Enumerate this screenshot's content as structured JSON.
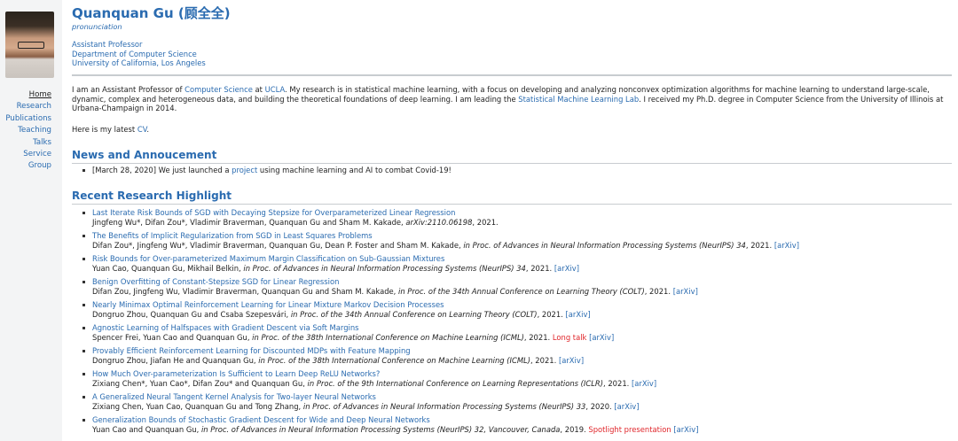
{
  "profile": {
    "name": "Quanquan Gu (顾全全)",
    "pronunciation": "pronunciation",
    "affiliation": [
      "Assistant Professor",
      "Department of Computer Science",
      "University of California, Los Angeles"
    ]
  },
  "nav": [
    "Home",
    "Research",
    "Publications",
    "Teaching",
    "Talks",
    "Service",
    "Group"
  ],
  "intro": {
    "p1_a": "I am an Assistant Professor of ",
    "p1_link1": "Computer Science",
    "p1_b": " at ",
    "p1_link2": "UCLA",
    "p1_c": ". My research is in statistical machine learning, with a focus on developing and analyzing nonconvex optimization algorithms for machine learning to understand large-scale, dynamic, complex and heterogeneous data, and building the theoretical foundations of deep learning. I am leading the ",
    "p1_link3": "Statistical Machine Learning Lab",
    "p1_d": ". I received my Ph.D. degree in Computer Science from the University of Illinois at Urbana-Champaign in 2014.",
    "p2_a": "Here is my latest ",
    "p2_link": "CV",
    "p2_b": "."
  },
  "news": {
    "heading": "News and Annoucement",
    "items": [
      {
        "a": "[March 28, 2020] We just launched a ",
        "link": "project",
        "b": " using machine learning and AI to combat Covid-19!"
      }
    ]
  },
  "research": {
    "heading": "Recent Research Highlight",
    "items": [
      {
        "title": "Last Iterate Risk Bounds of SGD with Decaying Stepsize for Overparameterized Linear Regression",
        "authors": "Jingfeng Wu*, Difan Zou*, Vladimir Braverman, Quanquan Gu and Sham M. Kakade, ",
        "venue": "arXiv:2110.06198",
        "year": ", 2021.",
        "badge": "",
        "arxiv": ""
      },
      {
        "title": "The Benefits of Implicit Regularization from SGD in Least Squares Problems",
        "authors": "Difan Zou*, Jingfeng Wu*, Vladimir Braverman, Quanquan Gu, Dean P. Foster and Sham M. Kakade, ",
        "venue": "in Proc. of Advances in Neural Information Processing Systems (NeurIPS) 34",
        "year": ", 2021. ",
        "badge": "",
        "arxiv": "[arXiv]"
      },
      {
        "title": "Risk Bounds for Over-parameterized Maximum Margin Classification on Sub-Gaussian Mixtures",
        "authors": "Yuan Cao, Quanquan Gu, Mikhail Belkin, ",
        "venue": "in Proc. of Advances in Neural Information Processing Systems (NeurIPS) 34",
        "year": ", 2021. ",
        "badge": "",
        "arxiv": "[arXiv]"
      },
      {
        "title": "Benign Overfitting of Constant-Stepsize SGD for Linear Regression",
        "authors": "Difan Zou, Jingfeng Wu, Vladimir Braverman, Quanquan Gu and Sham M. Kakade, ",
        "venue": "in Proc. of the 34th Annual Conference on Learning Theory (COLT)",
        "year": ", 2021. ",
        "badge": "",
        "arxiv": "[arXiv]"
      },
      {
        "title": "Nearly Minimax Optimal Reinforcement Learning for Linear Mixture Markov Decision Processes",
        "authors": "Dongruo Zhou, Quanquan Gu and Csaba Szepesvári, ",
        "venue": "in Proc. of the 34th Annual Conference on Learning Theory (COLT)",
        "year": ", 2021. ",
        "badge": "",
        "arxiv": "[arXiv]"
      },
      {
        "title": "Agnostic Learning of Halfspaces with Gradient Descent via Soft Margins",
        "authors": "Spencer Frei, Yuan Cao and Quanquan Gu, ",
        "venue": "in Proc. of the 38th International Conference on Machine Learning (ICML)",
        "year": ", 2021. ",
        "badge": "Long talk",
        "arxiv": "[arXiv]"
      },
      {
        "title": "Provably Efficient Reinforcement Learning for Discounted MDPs with Feature Mapping",
        "authors": "Dongruo Zhou, Jiafan He and Quanquan Gu, ",
        "venue": "in Proc. of the 38th International Conference on Machine Learning (ICML)",
        "year": ", 2021. ",
        "badge": "",
        "arxiv": "[arXiv]"
      },
      {
        "title": "How Much Over-parameterization Is Sufficient to Learn Deep ReLU Networks?",
        "authors": "Zixiang Chen*, Yuan Cao*, Difan Zou* and Quanquan Gu, ",
        "venue": "in Proc. of the 9th International Conference on Learning Representations (ICLR)",
        "year": ", 2021. ",
        "badge": "",
        "arxiv": "[arXiv]"
      },
      {
        "title": "A Generalized Neural Tangent Kernel Analysis for Two-layer Neural Networks",
        "authors": "Zixiang Chen, Yuan Cao, Quanquan Gu and Tong Zhang, ",
        "venue": "in Proc. of Advances in Neural Information Processing Systems (NeurIPS) 33",
        "year": ", 2020. ",
        "badge": "",
        "arxiv": "[arXiv]"
      },
      {
        "title": "Generalization Bounds of Stochastic Gradient Descent for Wide and Deep Neural Networks",
        "authors": "Yuan Cao and Quanquan Gu, ",
        "venue": "in Proc. of Advances in Neural Information Processing Systems (NeurIPS) 32, Vancouver, Canada",
        "year": ", 2019. ",
        "badge": "Spotlight presentation",
        "arxiv": "[arXiv]"
      }
    ]
  }
}
